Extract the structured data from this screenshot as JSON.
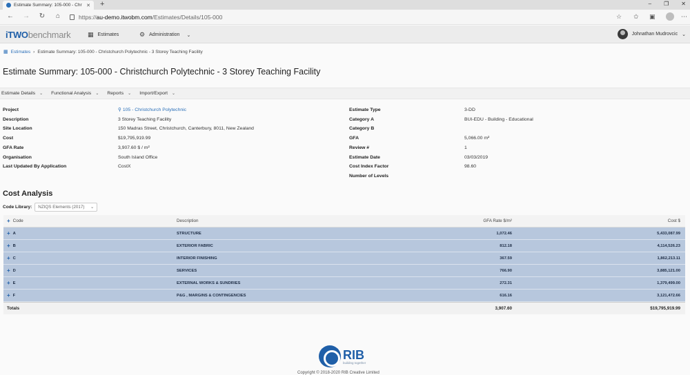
{
  "browser": {
    "tab_title": "Estimate Summary: 105-000 - Chr",
    "url_proto": "https://",
    "url_host": "au-demo.itwobm.com",
    "url_path": "/Estimates/Details/105-000"
  },
  "app": {
    "logo_main": "iTWO",
    "logo_sub": "benchmark",
    "menu_estimates": "Estimates",
    "menu_administration": "Administration",
    "user_name": "Johnathan Mudrovcic"
  },
  "breadcrumb": {
    "root": "Estimates",
    "current": "Estimate Summary: 105-000 - Christchurch Polytechnic - 3 Storey Teaching Facility"
  },
  "page_title": "Estimate Summary: 105-000 - Christchurch Polytechnic - 3 Storey Teaching Facility",
  "tabs": [
    "Estimate Details",
    "Functional Analysis",
    "Reports",
    "Import/Export"
  ],
  "details_left": [
    {
      "label": "Project",
      "value": "105 - Christchurch Polytechnic"
    },
    {
      "label": "Description",
      "value": "3 Storey Teaching Facility"
    },
    {
      "label": "Site Location",
      "value": "150 Madras Street, Christchurch, Canterbury, 8011, New Zealand"
    },
    {
      "label": "Cost",
      "value": "$19,795,919.99"
    },
    {
      "label": "GFA Rate",
      "value": "3,907.60 $ / m²"
    },
    {
      "label": "Organisation",
      "value": "South Island Office"
    },
    {
      "label": "Last Updated By Application",
      "value": "CostX"
    }
  ],
  "details_right": [
    {
      "label": "Estimate Type",
      "value": "3-DD"
    },
    {
      "label": "Category A",
      "value": "BUI-EDU - Building - Educational"
    },
    {
      "label": "Category B",
      "value": ""
    },
    {
      "label": "GFA",
      "value": "5,066.00 m²"
    },
    {
      "label": "Review #",
      "value": "1"
    },
    {
      "label": "Estimate Date",
      "value": "03/03/2019"
    },
    {
      "label": "Cost Index Factor",
      "value": "98.60"
    },
    {
      "label": "Number of Levels",
      "value": ""
    }
  ],
  "cost_analysis": {
    "heading": "Cost Analysis",
    "code_library_label": "Code Library:",
    "code_library_value": "NZIQS Elements (2017)",
    "columns": {
      "code": "Code",
      "description": "Description",
      "gfa_rate": "GFA Rate $/m²",
      "cost": "Cost $"
    },
    "rows": [
      {
        "code": "A",
        "description": "STRUCTURE",
        "gfa_rate": "1,072.46",
        "cost": "5,433,087.99"
      },
      {
        "code": "B",
        "description": "EXTERIOR FABRIC",
        "gfa_rate": "812.18",
        "cost": "4,114,526.23"
      },
      {
        "code": "C",
        "description": "INTERIOR FINISHING",
        "gfa_rate": "367.59",
        "cost": "1,862,213.11"
      },
      {
        "code": "D",
        "description": "SERVICES",
        "gfa_rate": "766.90",
        "cost": "3,885,121.00"
      },
      {
        "code": "E",
        "description": "EXTERNAL WORKS & SUNDRIES",
        "gfa_rate": "272.31",
        "cost": "1,379,499.00"
      },
      {
        "code": "F",
        "description": "P&G , MARGINS & CONTINGENCIES",
        "gfa_rate": "616.16",
        "cost": "3,121,472.66"
      }
    ],
    "totals": {
      "label": "Totals",
      "gfa_rate": "3,907.60",
      "cost": "$19,795,919.99"
    }
  },
  "footer": {
    "brand": "RIB",
    "tagline": "building together",
    "copyright": "Copyright © 2018-2020 RIB Creative Limited"
  }
}
